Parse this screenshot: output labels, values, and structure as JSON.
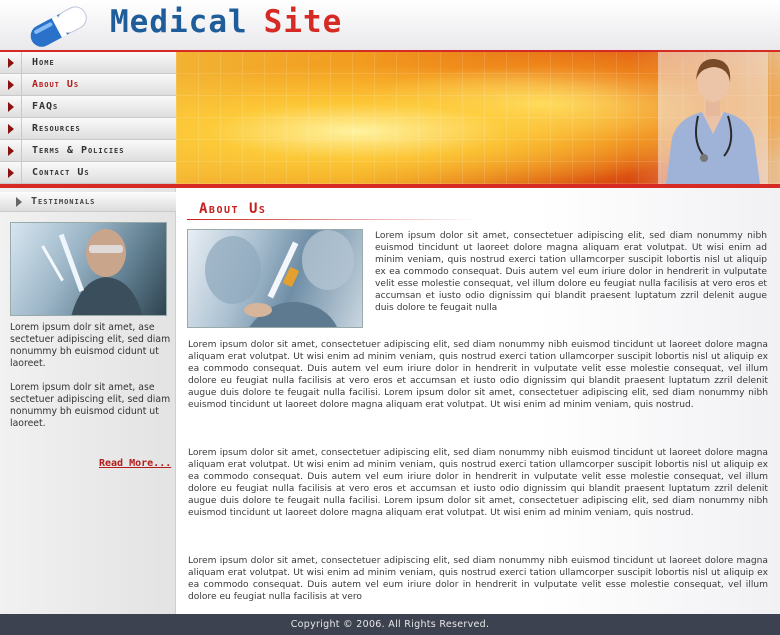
{
  "site": {
    "name_part1": "Medical",
    "name_part2": "Site"
  },
  "nav": {
    "items": [
      {
        "label": "Home"
      },
      {
        "label": "About Us"
      },
      {
        "label": "FAQs"
      },
      {
        "label": "Resources"
      },
      {
        "label": "Terms & Policies"
      },
      {
        "label": "Contact Us"
      }
    ],
    "active_index": 1
  },
  "sidebar": {
    "heading": "Testimonials",
    "testimonial_1": "Lorem ipsum dolr sit amet, ase sectetuer adipiscing elit, sed diam nonummy bh euismod cidunt ut laoreet.",
    "testimonial_2": "Lorem ipsum dolr sit amet, ase sectetuer adipiscing elit, sed diam nonummy bh euismod cidunt ut laoreet.",
    "read_more": "Read More..."
  },
  "main": {
    "title": "About Us",
    "intro": "Lorem ipsum dolor sit amet, consectetuer adipiscing elit, sed diam nonummy nibh euismod tincidunt ut laoreet dolore magna aliquam erat volutpat. Ut wisi enim ad minim veniam, quis nostrud exerci tation ullamcorper suscipit lobortis nisl ut aliquip ex ea commodo consequat. Duis autem vel eum iriure dolor in hendrerit in vulputate velit esse molestie consequat, vel illum dolore eu feugiat nulla facilisis at vero eros et accumsan et iusto odio dignissim qui blandit praesent luptatum zzril delenit augue duis dolore te feugait nulla",
    "paragraph_1": "Lorem ipsum dolor sit amet, consectetuer adipiscing elit, sed diam nonummy nibh euismod tincidunt ut laoreet dolore magna aliquam erat volutpat. Ut wisi enim ad minim veniam, quis nostrud exerci tation ullamcorper suscipit lobortis nisl ut aliquip ex ea commodo consequat. Duis autem vel eum iriure dolor in hendrerit in vulputate velit esse molestie consequat, vel illum dolore eu feugiat nulla facilisis at vero eros et accumsan et iusto odio dignissim qui blandit praesent luptatum zzril delenit augue duis dolore te feugait nulla facilisi. Lorem ipsum dolor sit amet, consectetuer adipiscing elit, sed diam nonummy nibh euismod tincidunt ut laoreet dolore magna aliquam erat volutpat. Ut wisi enim ad minim veniam, quis nostrud.",
    "paragraph_2": "Lorem ipsum dolor sit amet, consectetuer adipiscing elit, sed diam nonummy nibh euismod tincidunt ut laoreet dolore magna aliquam erat volutpat. Ut wisi enim ad minim veniam, quis nostrud exerci tation ullamcorper suscipit lobortis nisl ut aliquip ex ea commodo consequat. Duis autem vel eum iriure dolor in hendrerit in vulputate velit esse molestie consequat, vel illum dolore eu feugiat nulla facilisis at vero eros et accumsan et iusto odio dignissim qui blandit praesent luptatum zzril delenit augue duis dolore te feugait nulla facilisi. Lorem ipsum dolor sit amet, consectetuer adipiscing elit, sed diam nonummy nibh euismod tincidunt ut laoreet dolore magna aliquam erat volutpat. Ut wisi enim ad minim veniam, quis nostrud.",
    "paragraph_3": "Lorem ipsum dolor sit amet, consectetuer adipiscing elit, sed diam nonummy nibh euismod tincidunt ut laoreet dolore magna aliquam erat volutpat. Ut wisi enim ad minim veniam, quis nostrud exerci tation ullamcorper suscipit lobortis nisl ut aliquip ex ea commodo consequat. Duis autem vel eum iriure dolor in hendrerit in vulputate velit esse molestie consequat, vel illum dolore eu feugiat nulla facilisis at vero"
  },
  "footer": {
    "copyright": "Copyright © 2006. All Rights Reserved."
  },
  "colors": {
    "accent_red": "#d62b25",
    "brand_blue": "#1e5c9a",
    "footer_bg": "#3d4250"
  },
  "icons": {
    "logo": "capsule-pill-icon",
    "nav_bullet": "triangle-right-icon"
  }
}
